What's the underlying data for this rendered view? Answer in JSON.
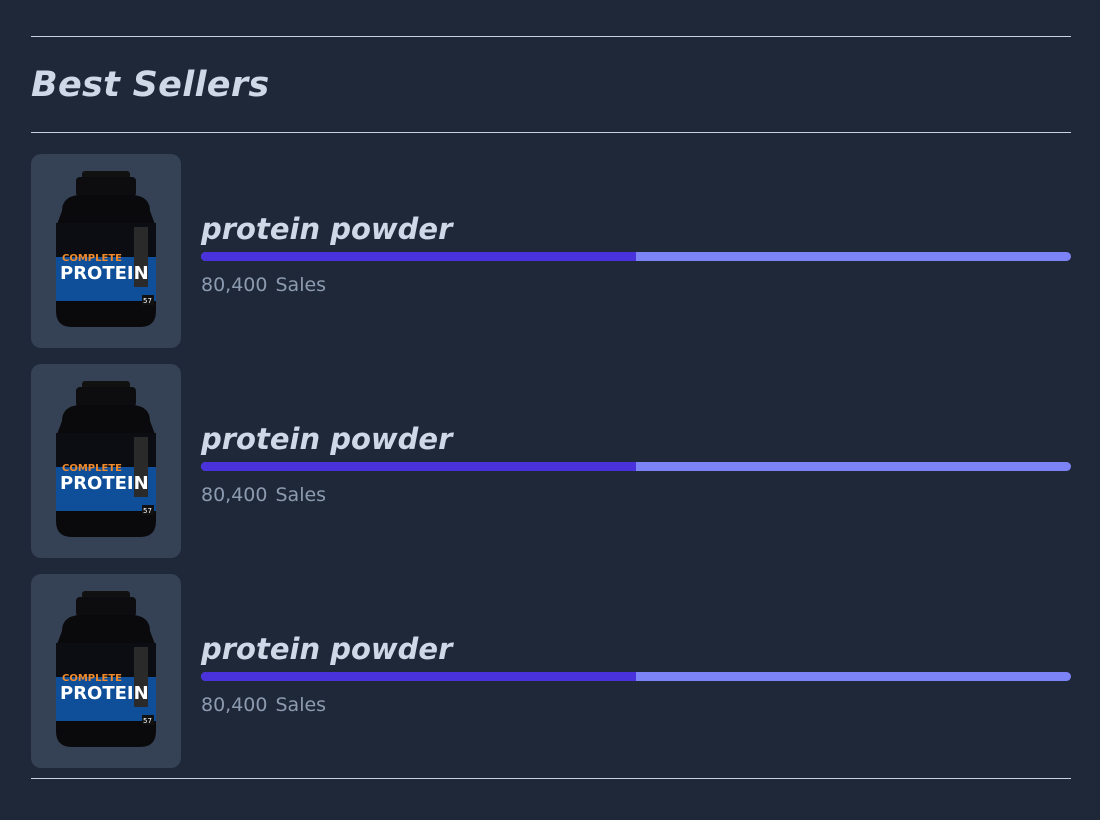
{
  "section": {
    "title": "Best Sellers"
  },
  "colors": {
    "background": "#1f2839",
    "card": "#354155",
    "bar_fill": "#4932db",
    "bar_track": "#7b83f7",
    "text": "#cfd8e6",
    "muted": "#8d9bb0"
  },
  "products": [
    {
      "name": "protein powder",
      "sales_value": "80,400",
      "sales_unit": "Sales",
      "progress": 0.5,
      "image_icon": "protein-tub-icon",
      "image_text": "COMPLETE PROTEIN"
    },
    {
      "name": "protein powder",
      "sales_value": "80,400",
      "sales_unit": "Sales",
      "progress": 0.5,
      "image_icon": "protein-tub-icon",
      "image_text": "COMPLETE PROTEIN"
    },
    {
      "name": "protein powder",
      "sales_value": "80,400",
      "sales_unit": "Sales",
      "progress": 0.5,
      "image_icon": "protein-tub-icon",
      "image_text": "COMPLETE PROTEIN"
    }
  ]
}
